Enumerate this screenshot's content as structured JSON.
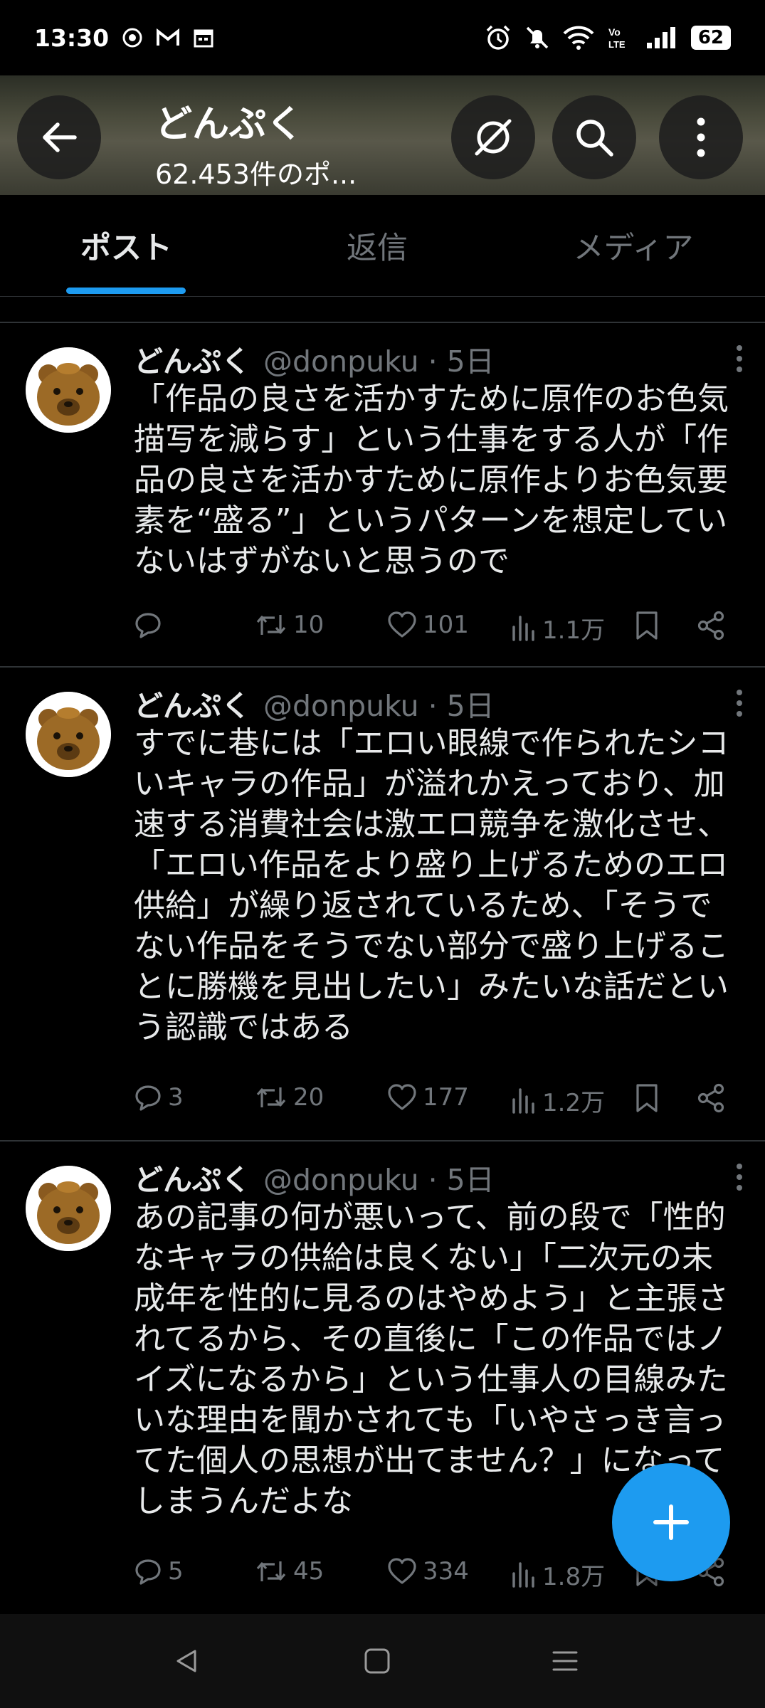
{
  "status_bar": {
    "time": "13:30",
    "battery": "62",
    "left_icons": [
      "camera-icon",
      "gmail-icon",
      "calendar-icon"
    ],
    "right_icons": [
      "alarm-icon",
      "mute-icon",
      "wifi-icon",
      "volte-icon",
      "signal-icon"
    ]
  },
  "header": {
    "title": "どんぷく",
    "subtitle": "62.453件のポ..."
  },
  "tabs": [
    {
      "label": "ポスト",
      "active": true
    },
    {
      "label": "返信",
      "active": false
    },
    {
      "label": "メディア",
      "active": false
    }
  ],
  "tweets": [
    {
      "name": "どんぷく",
      "handle": "@donpuku · 5日",
      "lines": [
        "「作品の良さを活かすために原作のお色気",
        "描写を減らす」という仕事をする人が「作",
        "品の良さを活かすために原作よりお色気要",
        "素を“盛る”」というパターンを想定してい",
        "ないはずがないと思うので"
      ],
      "replies": "",
      "retweets": "10",
      "likes": "101",
      "views": "1.1万"
    },
    {
      "name": "どんぷく",
      "handle": "@donpuku · 5日",
      "lines": [
        "すでに巷には「エロい眼線で作られたシコ",
        "いキャラの作品」が溢れかえっており、加",
        "速する消費社会は激エロ競争を激化させ、",
        "「エロい作品をより盛り上げるためのエロ",
        "供給」が繰り返されているため、「そうで",
        "ない作品をそうでない部分で盛り上げるこ",
        "とに勝機を見出したい」みたいな話だとい",
        "う認識ではある"
      ],
      "replies": "3",
      "retweets": "20",
      "likes": "177",
      "views": "1.2万"
    },
    {
      "name": "どんぷく",
      "handle": "@donpuku · 5日",
      "lines": [
        "あの記事の何が悪いって、前の段で「性的",
        "なキャラの供給は良くない」「二次元の未",
        "成年を性的に見るのはやめよう」と主張さ",
        "れてるから、その直後に「この作品ではノ",
        "イズになるから」という仕事人の目線みた",
        "いな理由を聞かされても「いやさっき言っ",
        "てた個人の思想が出てません？」になって",
        "しまうんだよな"
      ],
      "replies": "5",
      "retweets": "45",
      "likes": "334",
      "views": "1.8万"
    }
  ],
  "colors": {
    "background": "#000000",
    "text": "#e7e9ea",
    "muted": "#71767b",
    "accent": "#1d9bf0",
    "divider": "#2f3336"
  }
}
